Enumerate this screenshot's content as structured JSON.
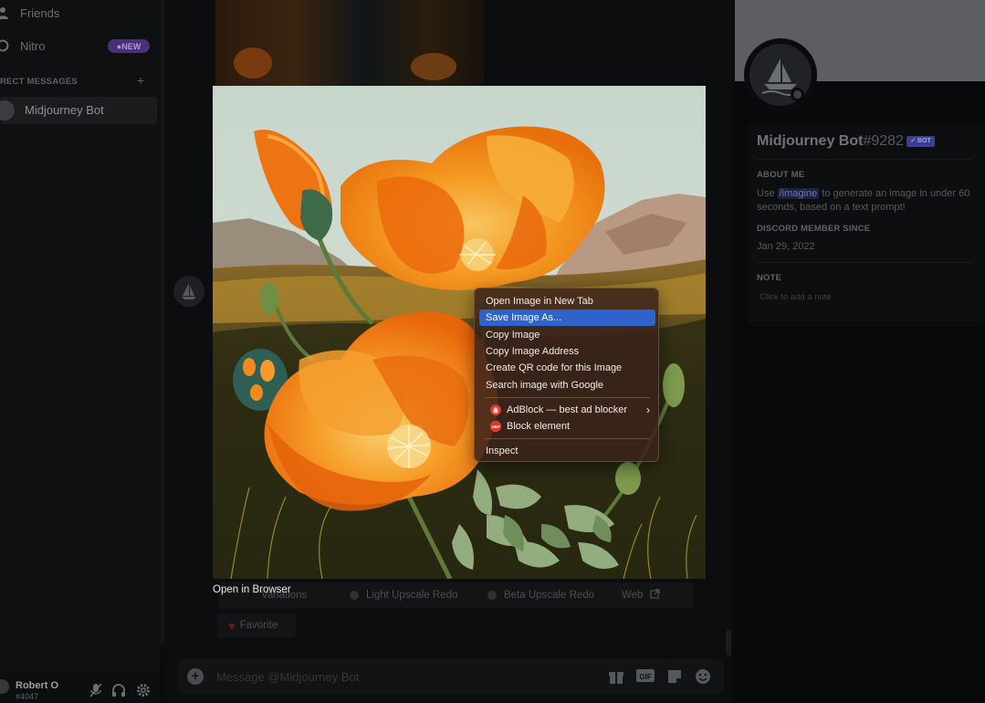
{
  "sidebar": {
    "friends_label": "Friends",
    "nitro_label": "Nitro",
    "nitro_badge": "NEW",
    "dm_header": "RECT MESSAGES",
    "dm_add": "+",
    "dm_items": [
      {
        "name": "Midjourney Bot"
      }
    ],
    "user": {
      "name": "Robert O",
      "tag": "#4047"
    }
  },
  "chat": {
    "buttons": [
      "Variations",
      "Light Upscale Redo",
      "Beta Upscale Redo",
      "Web"
    ],
    "favorite_label": "Favorite",
    "input_placeholder": "Message @Midjourney Bot"
  },
  "profile": {
    "name": "Midjourney Bot",
    "discriminator": "#9282",
    "badge": "✓ BOT",
    "about_header": "ABOUT ME",
    "about_pre": "Use ",
    "about_cmd": "/imagine",
    "about_post": " to generate an image in under 60 seconds, based on a text prompt!",
    "member_header": "DISCORD MEMBER SINCE",
    "member_since": "Jan 29, 2022",
    "note_header": "NOTE",
    "note_placeholder": "Click to add a note"
  },
  "image_viewer": {
    "open_in_browser": "Open in Browser"
  },
  "context_menu": {
    "items": [
      "Open Image in New Tab",
      "Save Image As...",
      "Copy Image",
      "Copy Image Address",
      "Create QR code for this Image",
      "Search image with Google"
    ],
    "highlighted": "Save Image As...",
    "extensions": [
      {
        "label": "AdBlock — best ad blocker",
        "icon": "adblock-hand-icon",
        "color": "#e0362b",
        "has_submenu": true
      },
      {
        "label": "Block element",
        "icon": "abp-icon",
        "color": "#e0362b"
      }
    ],
    "inspect": "Inspect"
  },
  "colors": {
    "highlight": "#2e63cc",
    "poppy_orange": "#f07a12",
    "sky": "#c9d8cd"
  }
}
